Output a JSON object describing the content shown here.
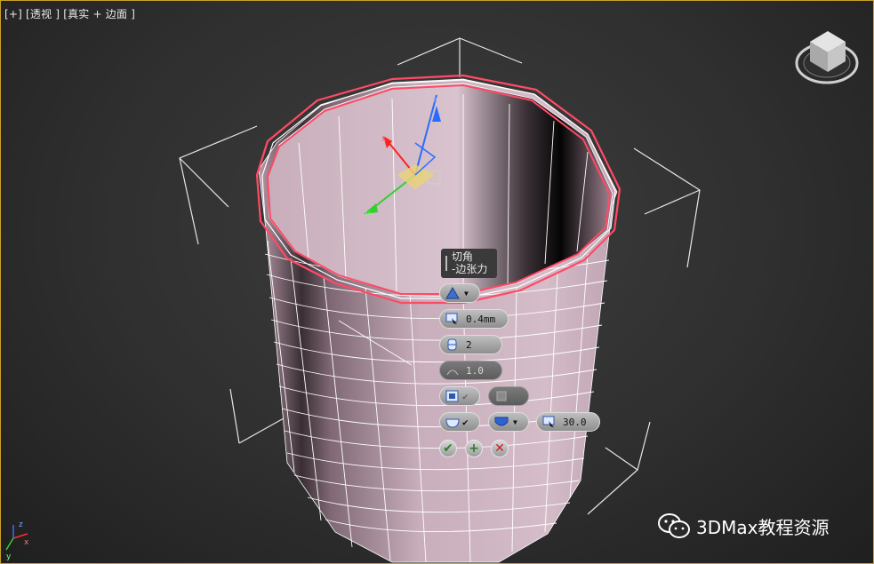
{
  "viewport": {
    "labels": [
      "[+]",
      "[透视 ]",
      "[真实 + 边面 ]"
    ],
    "accent_border": "#c9a227",
    "selection_edge_color": "#ff3b5c",
    "mesh_color": "#c9aab9"
  },
  "caddy": {
    "tooltip_line1": "切角",
    "tooltip_line2": "-边张力",
    "amount": "0.4mm",
    "segments": "2",
    "tension": "1.0",
    "smooth_threshold": "30.0",
    "icons": [
      "chamfer-type-icon",
      "amount-icon",
      "segments-icon",
      "tension-icon",
      "open-chamfer-icon",
      "invert-icon",
      "smooth-icon",
      "smooth-type-icon",
      "threshold-icon"
    ],
    "buttons": [
      "ok-check-icon",
      "apply-plus-icon",
      "cancel-x-icon"
    ]
  },
  "axis_tripod": {
    "x": "x",
    "y": "y",
    "z": "z"
  },
  "watermark": {
    "text": "3DMax教程资源"
  }
}
